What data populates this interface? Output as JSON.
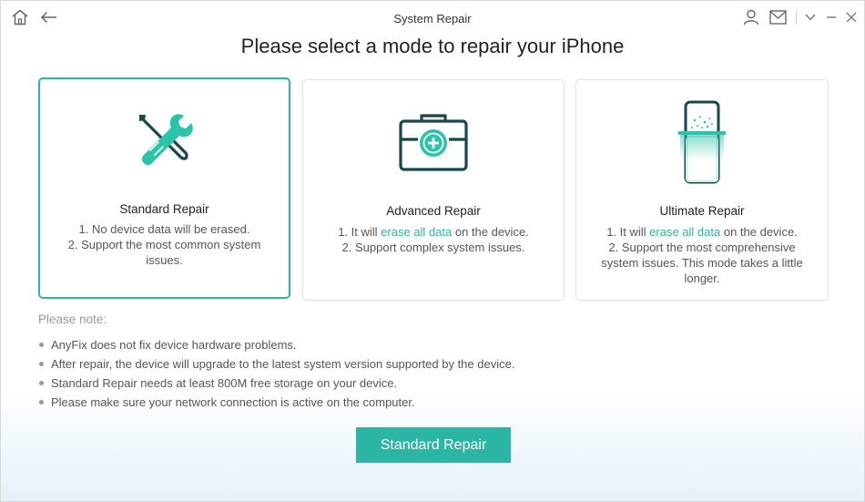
{
  "window": {
    "title": "System Repair"
  },
  "headline": "Please select a mode to repair your iPhone",
  "colors": {
    "accent": "#2bb5a5",
    "accent_dark": "#0e4d52"
  },
  "modes": [
    {
      "title": "Standard Repair",
      "selected": true,
      "icon": "tools-icon",
      "desc": [
        "1. No device data will be erased.",
        "2. Support the most common system issues."
      ]
    },
    {
      "title": "Advanced Repair",
      "selected": false,
      "icon": "toolbox-icon",
      "desc1_pre": "1. It will ",
      "desc1_hl": "erase all data",
      "desc1_post": " on the device.",
      "desc2": "2. Support complex system issues."
    },
    {
      "title": "Ultimate Repair",
      "selected": false,
      "icon": "phone-scan-icon",
      "desc1_pre": "1. It will ",
      "desc1_hl": "erase all data",
      "desc1_post": " on the device.",
      "desc2": "2. Support the most comprehensive system issues. This mode takes a little longer."
    }
  ],
  "note": {
    "title": "Please note:",
    "items": [
      "AnyFix does not fix device hardware problems.",
      "After repair, the device will upgrade to the latest system version supported by the device.",
      "Standard Repair needs at least 800M free storage on your device.",
      "Please make sure your network connection is active on the computer."
    ]
  },
  "primary_button": "Standard Repair"
}
